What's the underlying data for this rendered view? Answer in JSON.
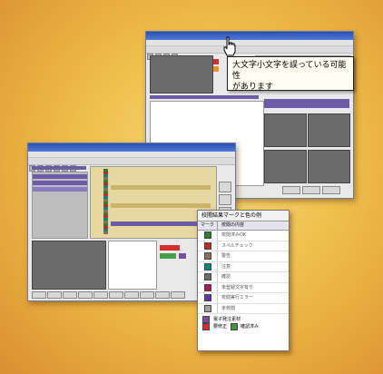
{
  "callout": {
    "line1": "大文字小文字を誤っている可能性",
    "line2": "があります"
  },
  "legend": {
    "title": "校閲結果マークと色の例",
    "head_mark": "マーク",
    "head_content": "校閲の内容",
    "rows": [
      {
        "label": "校閲済みOK",
        "color": "#2e7d32"
      },
      {
        "label": "スペルチェック",
        "color": "#c62828"
      },
      {
        "label": "警告",
        "color": "#8d6e63"
      },
      {
        "label": "注意",
        "color": "#00897b"
      },
      {
        "label": "確認",
        "color": "#6d6d6d"
      },
      {
        "label": "未登録文字有り",
        "color": "#ad1457"
      },
      {
        "label": "校閲実行エラー",
        "color": "#5e35b1"
      },
      {
        "label": "未校閲",
        "color": "#9e9e9e"
      }
    ],
    "footer1": "電子発注素材",
    "footer2a": "要修正",
    "footer2b": "確認済み",
    "footer_colors": {
      "order": "#7b4fa0",
      "fix": "#d32f2f",
      "ok": "#3a9a3a"
    }
  }
}
